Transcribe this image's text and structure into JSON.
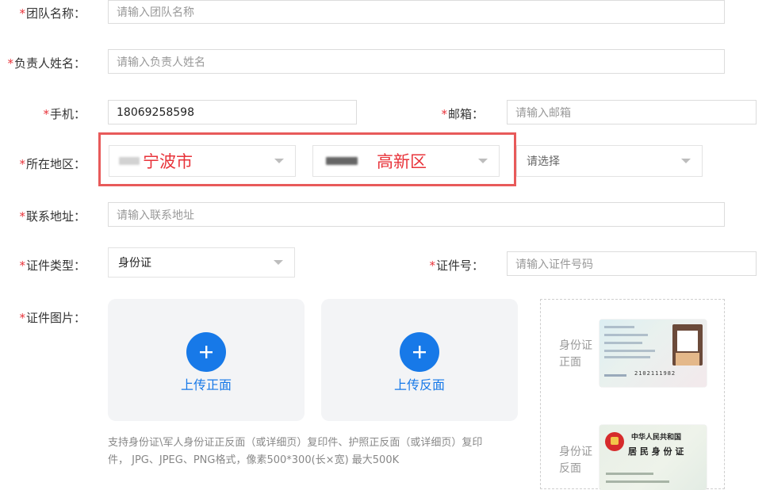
{
  "form": {
    "team_name": {
      "label": "团队名称：",
      "placeholder": "请输入团队名称"
    },
    "leader_name": {
      "label": "负责人姓名：",
      "placeholder": "请输入负责人姓名"
    },
    "phone": {
      "label": "手机：",
      "value": "18069258598"
    },
    "email": {
      "label": "邮箱：",
      "placeholder": "请输入邮箱"
    },
    "region": {
      "label": "所在地区：",
      "city": "宁波市",
      "district": "高新区",
      "third_placeholder": "请选择"
    },
    "address": {
      "label": "联系地址：",
      "placeholder": "请输入联系地址"
    },
    "id_type": {
      "label": "证件类型：",
      "value": "身份证"
    },
    "id_number": {
      "label": "证件号：",
      "placeholder": "请输入证件号码"
    },
    "id_images": {
      "label": "证件图片：",
      "front_label": "上传正面",
      "back_label": "上传反面",
      "hint_line1": "支持身份证\\军人身份证正反面（或详细页）复印件、护照正反面（或详细页）复印",
      "hint_line2": "件， JPG、JPEG、PNG格式，像素500*300(长×宽) 最大500K"
    },
    "samples": {
      "front_line1": "身份证",
      "front_line2": "正面",
      "back_line1": "身份证",
      "back_line2": "反面",
      "card_front_number": "2102111982",
      "card_back_title": "中华人民共和国",
      "card_back_subtitle": "居 民 身 份 证"
    }
  },
  "colors": {
    "required": "#e8333a",
    "accent": "#1779e8",
    "highlight_border": "#e85a5a",
    "highlight_text": "#e8333a"
  }
}
